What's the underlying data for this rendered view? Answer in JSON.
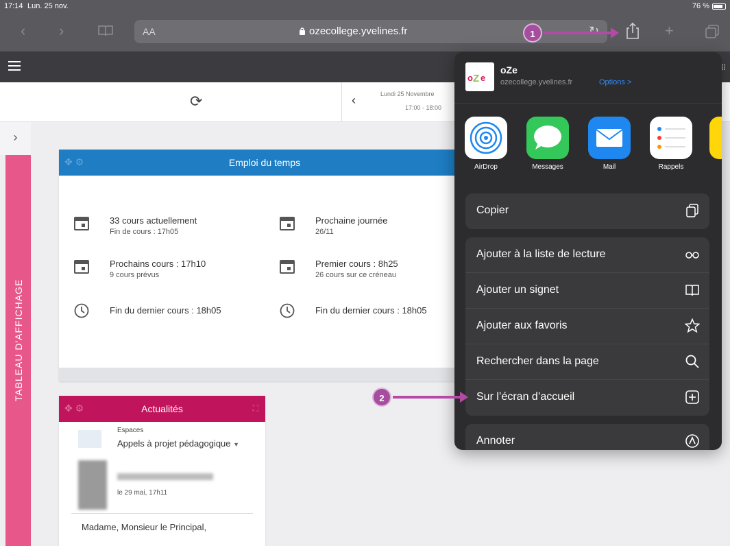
{
  "status_bar": {
    "time": "17:14",
    "date": "Lun. 25 nov.",
    "battery": "76 %"
  },
  "safari": {
    "text_size_label": "AA",
    "url": "ozecollege.yvelines.fr"
  },
  "subheader": {
    "date_line": "Lundi 25 Novembre",
    "time_range": "17:00 - 18:00"
  },
  "side_panel": {
    "label": "TABLEAU D'AFFICHAGE"
  },
  "emploi_du_temps": {
    "title": "Emploi du temps",
    "stats": [
      {
        "title": "33 cours actuellement",
        "sub": "Fin de cours : 17h05",
        "icon": "calendar-icon"
      },
      {
        "title": "Prochaine journée",
        "sub": "26/11",
        "icon": "calendar-icon"
      },
      {
        "title": "Prochains cours : 17h10",
        "sub": "9 cours prévus",
        "icon": "calendar-icon"
      },
      {
        "title": "Premier cours : 8h25",
        "sub": "26 cours sur ce créneau",
        "icon": "calendar-icon"
      },
      {
        "title": "Fin du dernier cours : 18h05",
        "sub": "",
        "icon": "clock-icon"
      },
      {
        "title": "Fin du dernier cours : 18h05",
        "sub": "",
        "icon": "clock-icon"
      }
    ]
  },
  "actualites": {
    "title": "Actualités",
    "space_label": "Espaces",
    "space_value": "Appels à projet pédagogique",
    "timestamp": "le 29 mai, 17h11",
    "message": "Madame, Monsieur le Principal,"
  },
  "share_sheet": {
    "app_name": "oZe",
    "domain": "ozecollege.yvelines.fr",
    "options_label": "Options >",
    "apps": [
      {
        "label": "AirDrop",
        "icon": "airdrop-icon",
        "color": "#ffffff"
      },
      {
        "label": "Messages",
        "icon": "messages-icon",
        "color": "#34c759"
      },
      {
        "label": "Mail",
        "icon": "mail-icon",
        "color": "#1e88f0"
      },
      {
        "label": "Rappels",
        "icon": "reminders-icon",
        "color": "#ffffff"
      }
    ],
    "copy_label": "Copier",
    "actions": [
      {
        "label": "Ajouter à la liste de lecture",
        "icon": "reading-list-icon"
      },
      {
        "label": "Ajouter un signet",
        "icon": "bookmark-book-icon"
      },
      {
        "label": "Ajouter aux favoris",
        "icon": "star-icon"
      },
      {
        "label": "Rechercher dans la page",
        "icon": "magnifier-icon"
      },
      {
        "label": "Sur l’écran d’accueil",
        "icon": "add-square-icon"
      }
    ],
    "annotate_label": "Annoter"
  },
  "markers": [
    {
      "number": "1"
    },
    {
      "number": "2"
    }
  ],
  "colors": {
    "edt_header": "#1e7dc3",
    "actualites_header": "#c0155c",
    "side_tab": "#e8578a",
    "marker": "#a64d9f"
  }
}
